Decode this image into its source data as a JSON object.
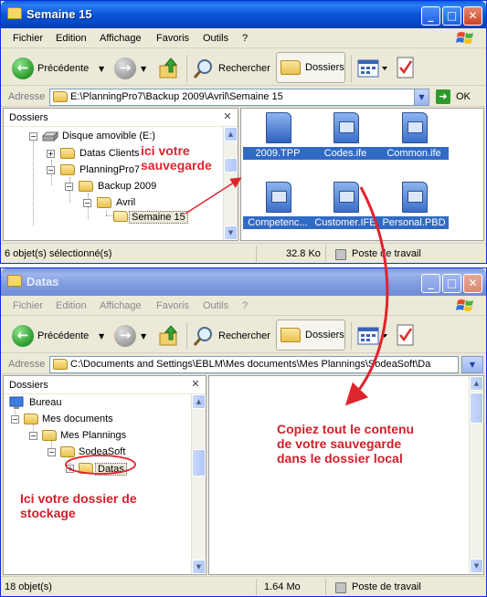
{
  "window1": {
    "title": "Semaine 15",
    "menu": [
      "Fichier",
      "Edition",
      "Affichage",
      "Favoris",
      "Outils",
      "?"
    ],
    "toolbar": {
      "back_label": "Précédente",
      "search_label": "Rechercher",
      "folders_label": "Dossiers"
    },
    "address": {
      "label": "Adresse",
      "value": "E:\\PlanningPro7\\Backup 2009\\Avril\\Semaine 15",
      "go_label": "OK"
    },
    "folders_pane": {
      "title": "Dossiers",
      "items": [
        {
          "label": "Disque amovible (E:)"
        },
        {
          "label": "Datas Clients"
        },
        {
          "label": "PlanningPro7"
        },
        {
          "label": "Backup 2009"
        },
        {
          "label": "Avril"
        },
        {
          "label": "Semaine 15"
        }
      ]
    },
    "files": [
      {
        "name": "2009.TPP"
      },
      {
        "name": "Codes.ife"
      },
      {
        "name": "Common.ife"
      },
      {
        "name": "Competenc..."
      },
      {
        "name": "Customer.IFE"
      },
      {
        "name": "Personal.PBD"
      }
    ],
    "status": {
      "selection": "6 objet(s) sélectionné(s)",
      "size": "32.8 Ko",
      "location": "Poste de travail"
    }
  },
  "window2": {
    "title": "Datas",
    "menu": [
      "Fichier",
      "Edition",
      "Affichage",
      "Favoris",
      "Outils",
      "?"
    ],
    "toolbar": {
      "back_label": "Précédente",
      "search_label": "Rechercher",
      "folders_label": "Dossiers"
    },
    "address": {
      "label": "Adresse",
      "value": "C:\\Documents and Settings\\EBLM\\Mes documents\\Mes Plannings\\SodeaSoft\\Da"
    },
    "folders_pane": {
      "title": "Dossiers",
      "items": [
        {
          "label": "Bureau"
        },
        {
          "label": "Mes documents"
        },
        {
          "label": "Mes Plannings"
        },
        {
          "label": "SodeaSoft"
        },
        {
          "label": "Datas"
        }
      ]
    },
    "status": {
      "count": "18 objet(s)",
      "size": "1.64 Mo",
      "location": "Poste de travail"
    }
  },
  "annotations": {
    "backup": "ici votre\nsauvegarde",
    "copy": "Copiez tout le contenu\nde votre sauvegarde\ndans le dossier local",
    "storage": "Ici votre dossier de\nstockage"
  },
  "colors": {
    "annotation": "#e0242e",
    "titlebar_active": "#0a56d6",
    "selection": "#316ac5"
  }
}
